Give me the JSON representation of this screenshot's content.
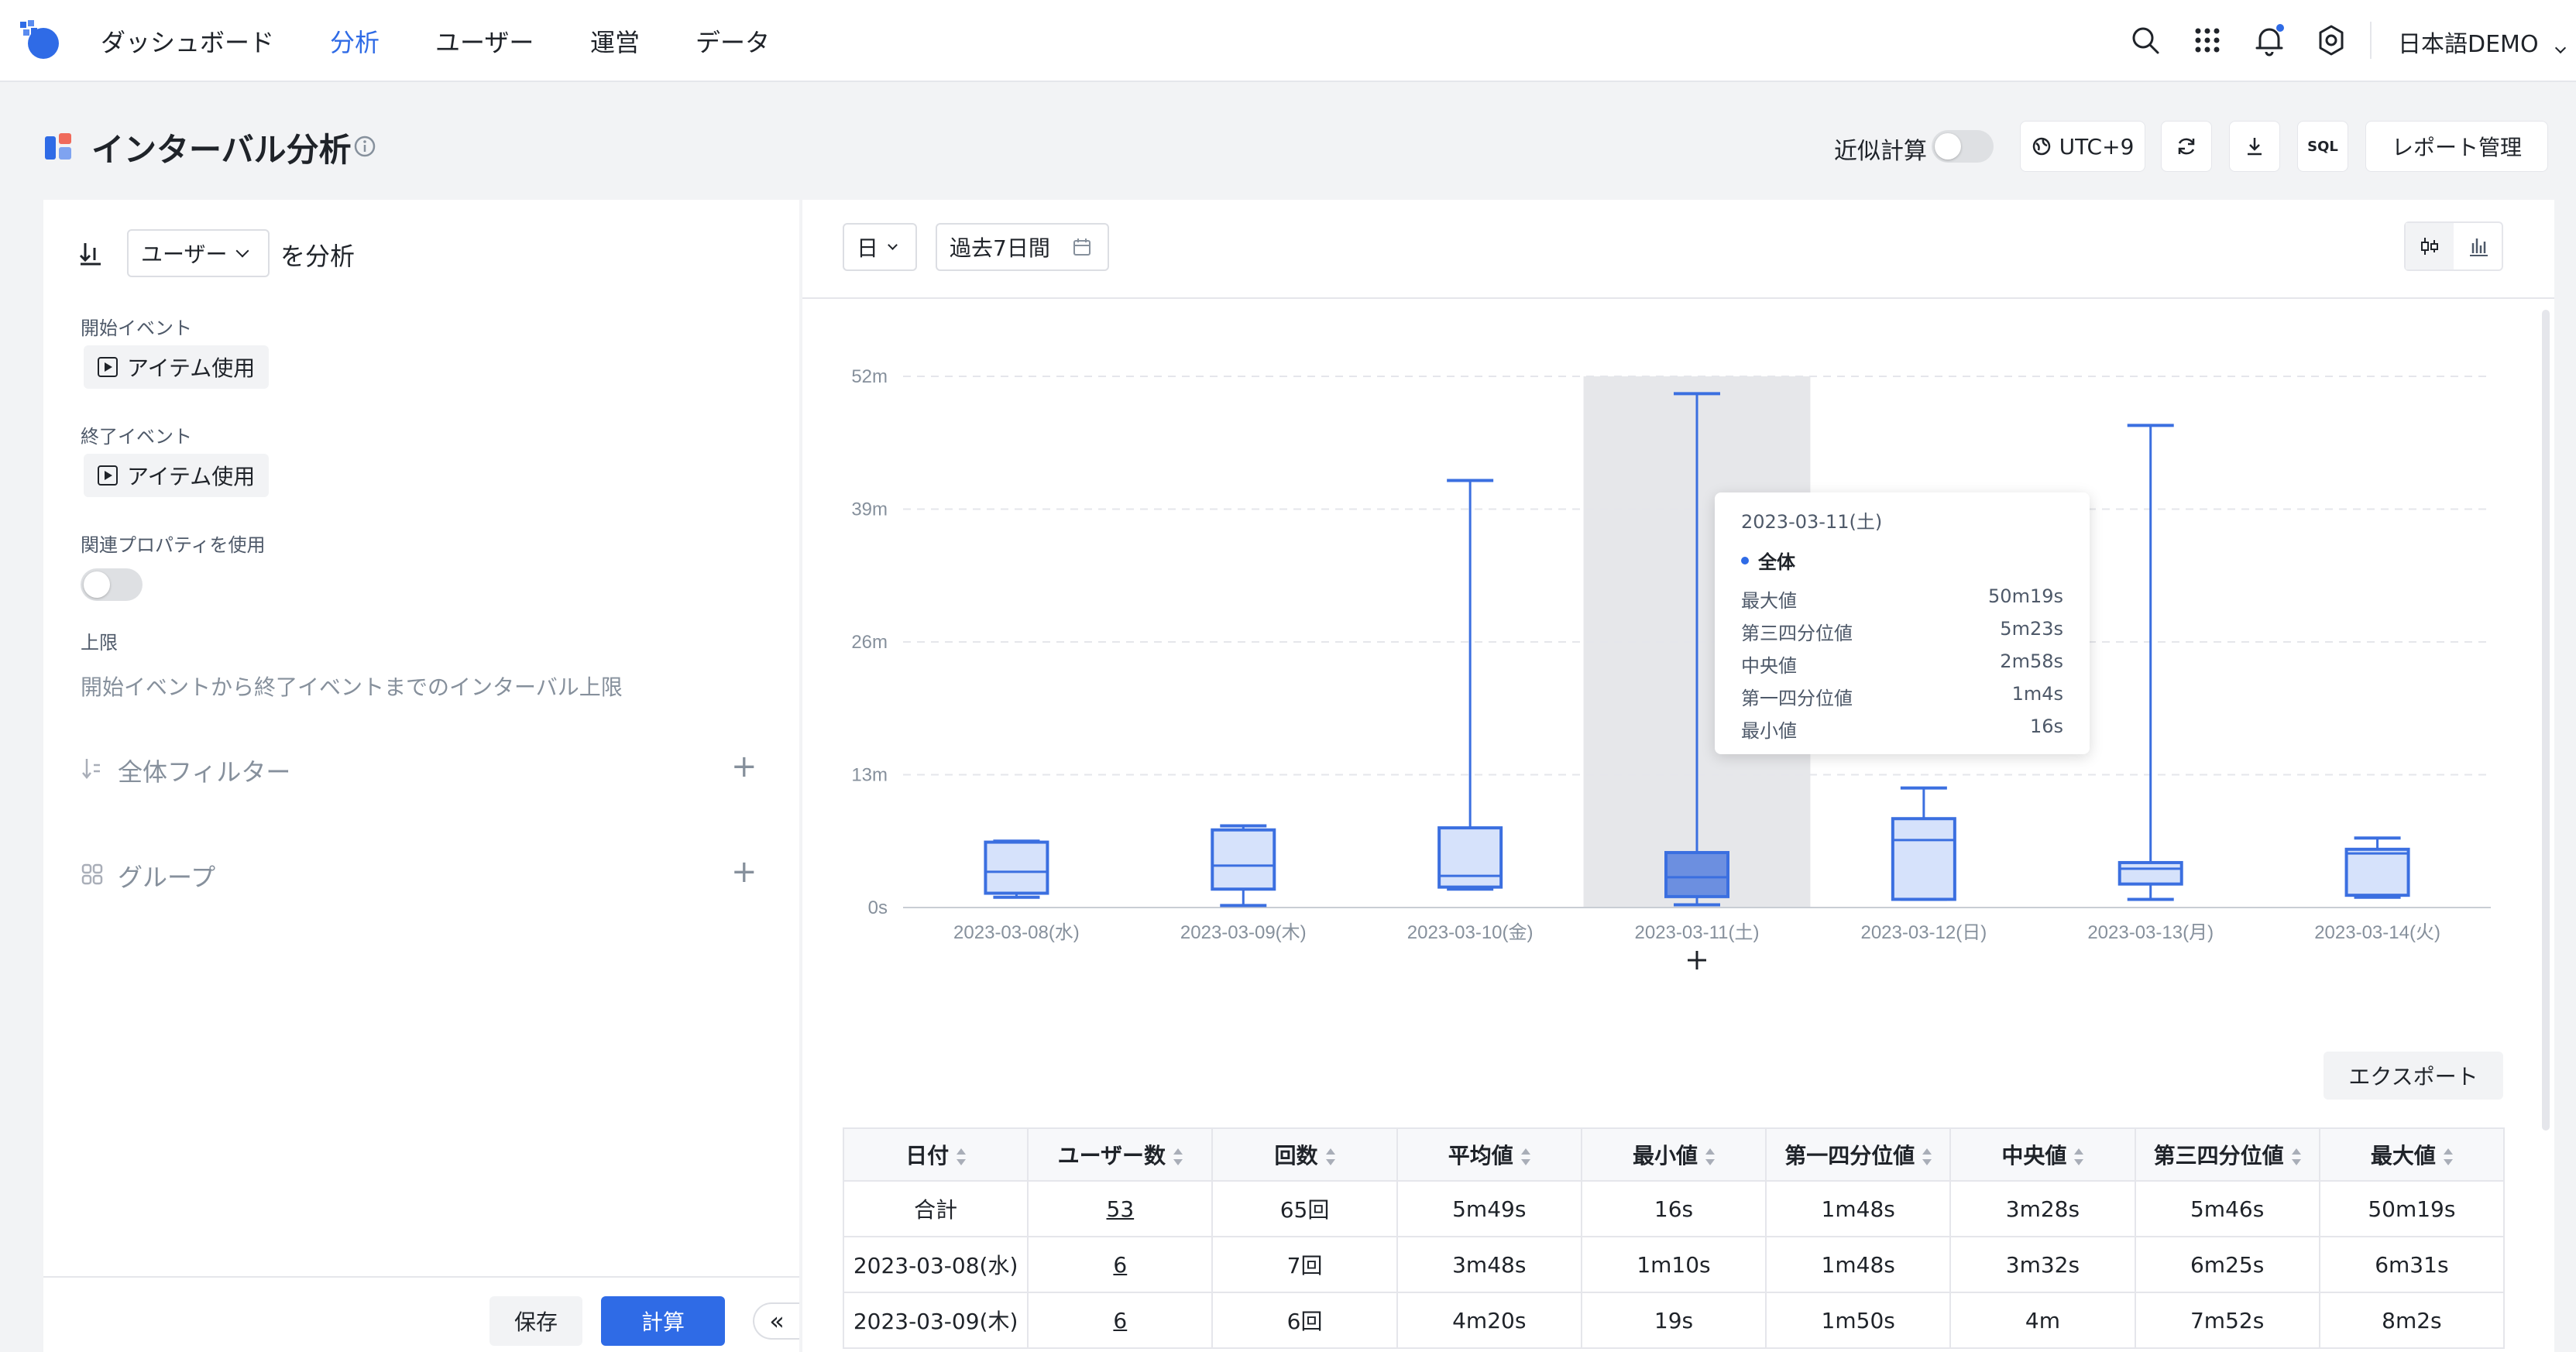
{
  "nav": {
    "items": [
      "ダッシュボード",
      "分析",
      "ユーザー",
      "運営",
      "データ"
    ],
    "active_index": 1,
    "language": "日本語DEMO"
  },
  "page": {
    "title": "インターバル分析",
    "approx_label": "近似計算",
    "timezone": "UTC+9",
    "sql_label": "SQL",
    "report_button": "レポート管理"
  },
  "left": {
    "analyze_subject": "ユーザー",
    "analyze_suffix": "を分析",
    "start_event_label": "開始イベント",
    "start_event": "アイテム使用",
    "end_event_label": "終了イベント",
    "end_event": "アイテム使用",
    "related_prop_label": "関連プロパティを使用",
    "limit_label": "上限",
    "limit_text": "開始イベントから終了イベントまでのインターバル上限",
    "global_filter": "全体フィルター",
    "group": "グループ",
    "save": "保存",
    "calc": "計算",
    "collapse": "«"
  },
  "controls": {
    "granularity": "日",
    "date_range": "過去7日間",
    "export": "エクスポート"
  },
  "chart_data": {
    "type": "boxplot",
    "yticks": [
      "0s",
      "13m",
      "26m",
      "39m",
      "52m"
    ],
    "ylim_minutes": [
      0,
      52
    ],
    "categories": [
      "2023-03-08(水)",
      "2023-03-09(木)",
      "2023-03-10(金)",
      "2023-03-11(土)",
      "2023-03-12(日)",
      "2023-03-13(月)",
      "2023-03-14(火)"
    ],
    "series": [
      {
        "min": 1.0,
        "q1": 1.4,
        "median": 3.5,
        "q3": 6.4,
        "max": 6.5
      },
      {
        "min": 0.2,
        "q1": 1.8,
        "median": 4.1,
        "q3": 7.6,
        "max": 8.0
      },
      {
        "min": 1.8,
        "q1": 2.0,
        "median": 3.1,
        "q3": 7.8,
        "max": 41.8
      },
      {
        "min": 0.27,
        "q1": 1.07,
        "median": 2.97,
        "q3": 5.38,
        "max": 50.3
      },
      {
        "min": 0.8,
        "q1": 0.8,
        "median": 6.6,
        "q3": 8.7,
        "max": 11.7
      },
      {
        "min": 0.8,
        "q1": 2.3,
        "median": 3.8,
        "q3": 4.4,
        "max": 47.2
      },
      {
        "min": 1.0,
        "q1": 1.2,
        "median": 5.3,
        "q3": 5.7,
        "max": 6.8
      }
    ],
    "highlight_index": 3,
    "tooltip": {
      "date": "2023-03-11(土)",
      "series_name": "全体",
      "rows": [
        {
          "label": "最大値",
          "value": "50m19s"
        },
        {
          "label": "第三四分位値",
          "value": "5m23s"
        },
        {
          "label": "中央値",
          "value": "2m58s"
        },
        {
          "label": "第一四分位値",
          "value": "1m4s"
        },
        {
          "label": "最小値",
          "value": "16s"
        }
      ]
    }
  },
  "table": {
    "headers": [
      "日付",
      "ユーザー数",
      "回数",
      "平均値",
      "最小値",
      "第一四分位値",
      "中央値",
      "第三四分位値",
      "最大値"
    ],
    "rows": [
      [
        "合計",
        "53",
        "65回",
        "5m49s",
        "16s",
        "1m48s",
        "3m28s",
        "5m46s",
        "50m19s"
      ],
      [
        "2023-03-08(水)",
        "6",
        "7回",
        "3m48s",
        "1m10s",
        "1m48s",
        "3m32s",
        "6m25s",
        "6m31s"
      ],
      [
        "2023-03-09(木)",
        "6",
        "6回",
        "4m20s",
        "19s",
        "1m50s",
        "4m",
        "7m52s",
        "8m2s"
      ]
    ]
  },
  "colors": {
    "accent": "#2f6be6",
    "box_fill": "#d6e2fb",
    "box_fill_active": "#6c8fe0",
    "box_stroke": "#3b6fe0"
  }
}
